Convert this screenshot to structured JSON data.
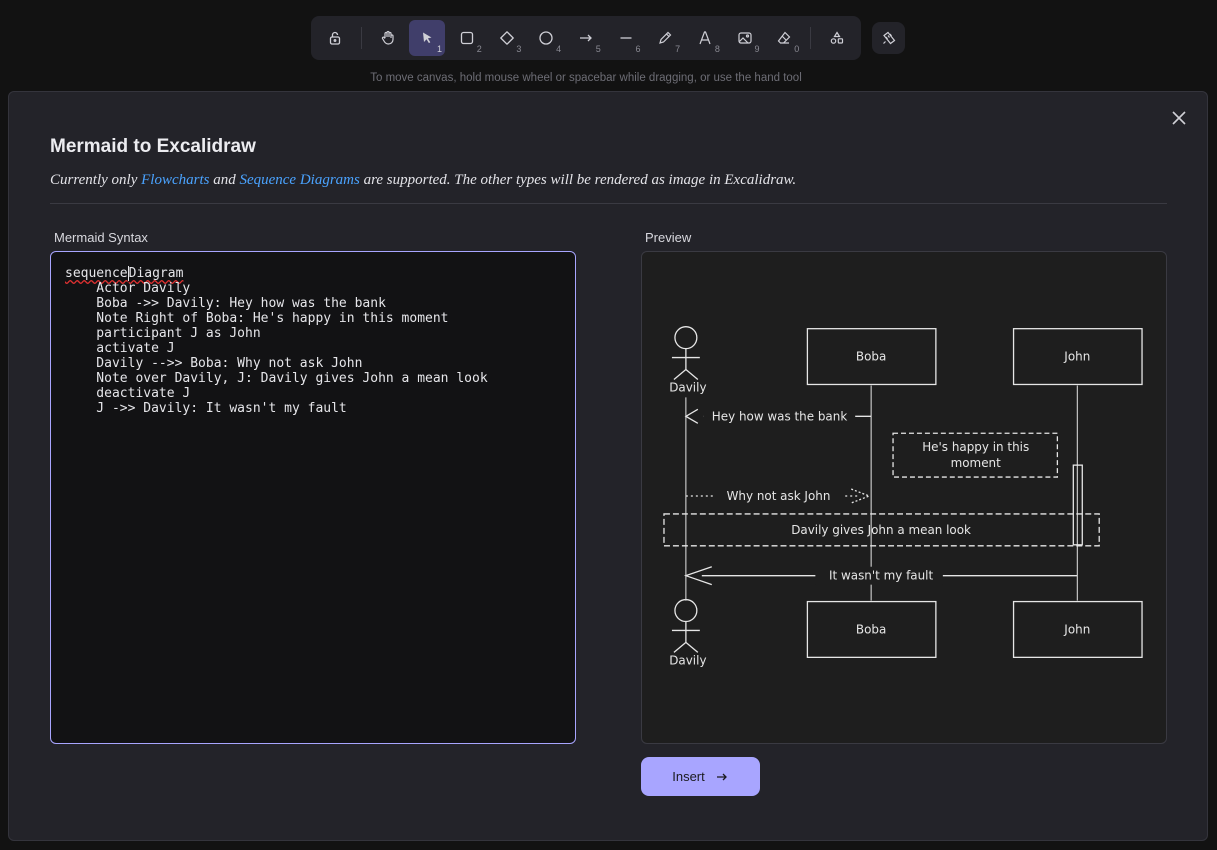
{
  "toolbar": {
    "tools": [
      {
        "name": "lock",
        "key": ""
      },
      {
        "name": "hand",
        "key": ""
      },
      {
        "name": "selection",
        "key": "1"
      },
      {
        "name": "rectangle",
        "key": "2"
      },
      {
        "name": "diamond",
        "key": "3"
      },
      {
        "name": "ellipse",
        "key": "4"
      },
      {
        "name": "arrow",
        "key": "5"
      },
      {
        "name": "line",
        "key": "6"
      },
      {
        "name": "draw",
        "key": "7"
      },
      {
        "name": "text",
        "key": "8"
      },
      {
        "name": "image",
        "key": "9"
      },
      {
        "name": "eraser",
        "key": "0"
      },
      {
        "name": "more-shapes",
        "key": ""
      }
    ],
    "active_tool": "selection"
  },
  "hint": "To move canvas, hold mouse wheel or spacebar while dragging, or use the hand tool",
  "dialog": {
    "title": "Mermaid to Excalidraw",
    "subtitle_prefix": "Currently only ",
    "link_flowcharts": "Flowcharts",
    "subtitle_and": " and ",
    "link_sequence": "Sequence Diagrams",
    "subtitle_suffix": " are supported. The other types will be rendered as image in Excalidraw.",
    "syntax_label": "Mermaid Syntax",
    "preview_label": "Preview",
    "code_first_a": "sequence",
    "code_first_b": "Diagram",
    "code_rest": "    Actor Davily\n    Boba ->> Davily: Hey how was the bank\n    Note Right of Boba: He's happy in this moment\n    participant J as John\n    activate J\n    Davily -->> Boba: Why not ask John\n    Note over Davily, J: Davily gives John a mean look\n    deactivate J\n    J ->> Davily: It wasn't my fault",
    "insert_label": "Insert",
    "preview": {
      "actor_davily": "Davily",
      "participant_boba": "Boba",
      "participant_john": "John",
      "msg1": "Hey how was the bank",
      "note1_line1": "He's happy in this",
      "note1_line2": "moment",
      "msg2": "Why not ask John",
      "note2": "Davily gives John a mean look",
      "msg3": "It wasn't my fault"
    }
  }
}
